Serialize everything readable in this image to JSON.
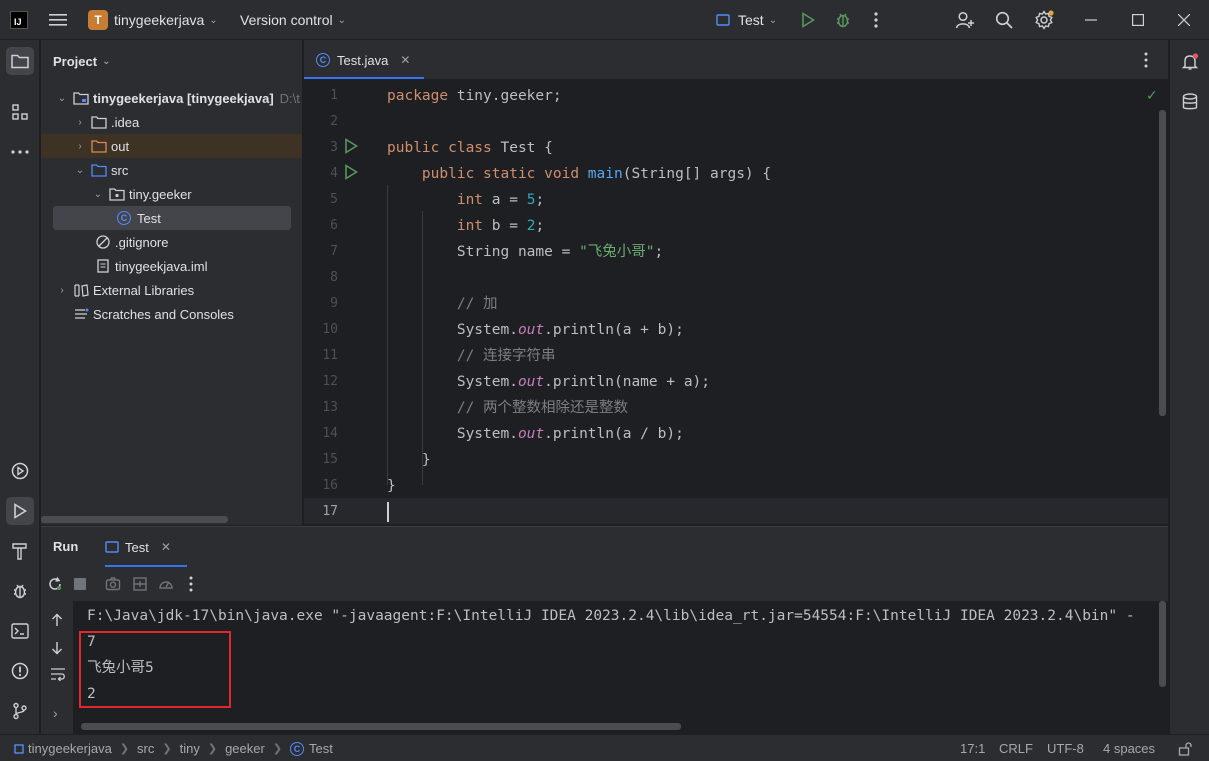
{
  "titlebar": {
    "app_logo": "IJ",
    "project_badge": "T",
    "project_name": "tinygeekerjava",
    "vcs": "Version control",
    "run_config": "Test"
  },
  "project_panel": {
    "title": "Project",
    "tree": [
      {
        "label": "tinygeekerjava [tinygeekjava]",
        "suffix": "D:\\t"
      },
      {
        "label": ".idea"
      },
      {
        "label": "out"
      },
      {
        "label": "src"
      },
      {
        "label": "tiny.geeker"
      },
      {
        "label": "Test"
      },
      {
        "label": ".gitignore"
      },
      {
        "label": "tinygeekjava.iml"
      },
      {
        "label": "External Libraries"
      },
      {
        "label": "Scratches and Consoles"
      }
    ]
  },
  "editor": {
    "tab": "Test.java",
    "line_numbers": [
      "1",
      "2",
      "3",
      "4",
      "5",
      "6",
      "7",
      "8",
      "9",
      "10",
      "11",
      "12",
      "13",
      "14",
      "15",
      "16",
      "17"
    ]
  },
  "run_panel": {
    "title": "Run",
    "tab": "Test",
    "command": "F:\\Java\\jdk-17\\bin\\java.exe \"-javaagent:F:\\IntelliJ IDEA 2023.2.4\\lib\\idea_rt.jar=54554:F:\\IntelliJ IDEA 2023.2.4\\bin\" -",
    "output": [
      "7",
      "飞兔小哥5",
      "2"
    ]
  },
  "statusbar": {
    "breadcrumb": [
      "tinygeekerjava",
      "src",
      "tiny",
      "geeker",
      "Test"
    ],
    "position": "17:1",
    "line_sep": "CRLF",
    "encoding": "UTF-8",
    "indent": "4 spaces"
  },
  "colors": {
    "accent": "#3574f0",
    "keyword": "#cf8e6d",
    "string": "#6aab73",
    "number": "#2aacb8",
    "highlight_box": "#e0282d"
  }
}
